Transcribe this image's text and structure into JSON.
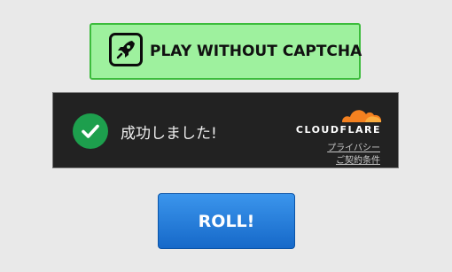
{
  "play_button": {
    "label": "PLAY WITHOUT CAPTCHA",
    "icon": "rocket-icon",
    "background_color": "#9ef19e",
    "border_color": "#3cbc3c"
  },
  "captcha_widget": {
    "status_icon": "checkmark-icon",
    "status_color": "#1d9f4d",
    "success_text": "成功しました!",
    "brand": {
      "icon": "cloudflare-cloud-icon",
      "name": "CLOUDFLARE",
      "color": "#f48120"
    },
    "links": {
      "privacy": "プライバシー",
      "terms": "ご契約条件"
    }
  },
  "roll_button": {
    "label": "ROLL!",
    "color": "#1f76d6"
  }
}
